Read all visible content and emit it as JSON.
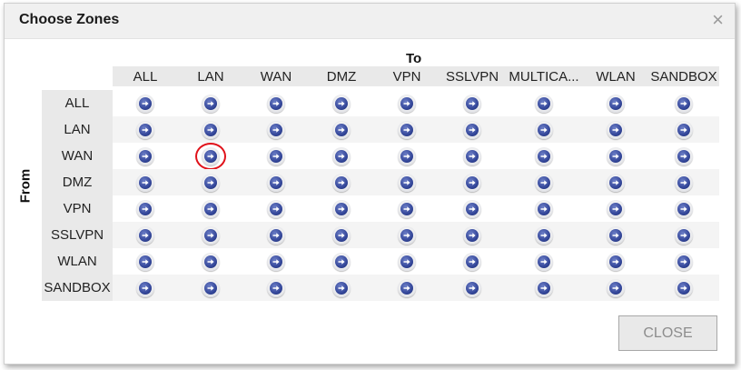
{
  "dialog": {
    "title": "Choose Zones",
    "close_icon": "×",
    "to_label": "To",
    "from_label": "From",
    "close_button": "CLOSE"
  },
  "columns": [
    "ALL",
    "LAN",
    "WAN",
    "DMZ",
    "VPN",
    "SSLVPN",
    "MULTICA...",
    "WLAN",
    "SANDBOX"
  ],
  "rows": [
    "ALL",
    "LAN",
    "WAN",
    "DMZ",
    "VPN",
    "SSLVPN",
    "WLAN",
    "SANDBOX"
  ],
  "icons": {
    "cell": "arrow-right-circle-icon"
  },
  "highlighted_cell": {
    "row": "WAN",
    "column": "LAN"
  },
  "colors": {
    "highlight": "#e0121a",
    "arrow": "#34479a"
  }
}
